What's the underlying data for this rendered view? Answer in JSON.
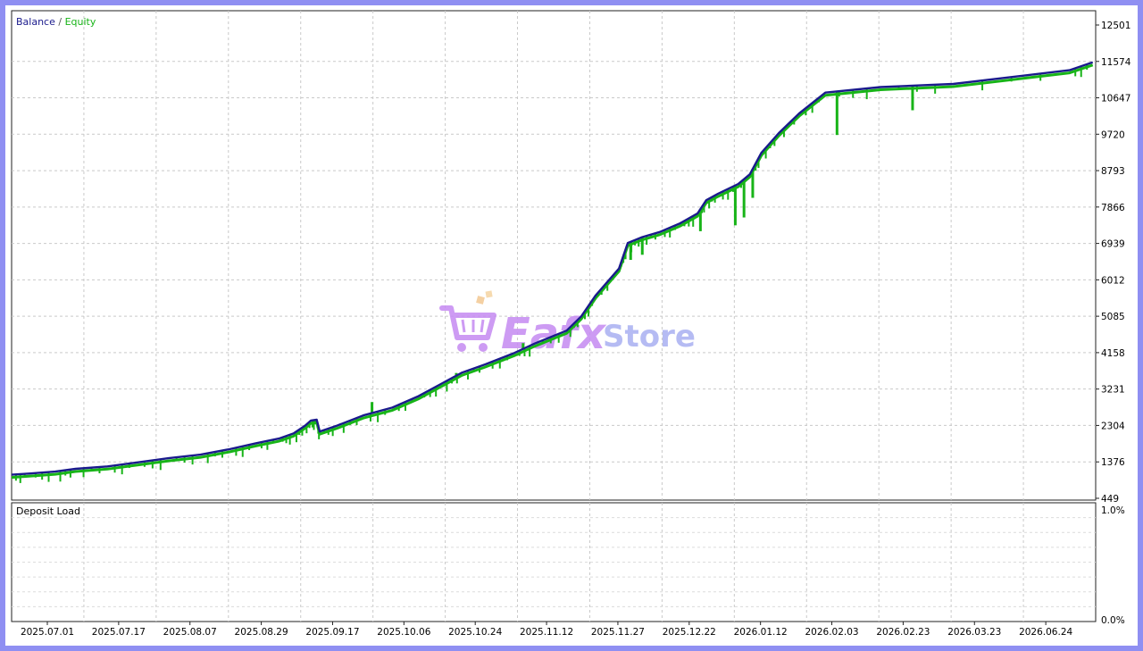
{
  "chart_data": [
    {
      "type": "line",
      "panel": "main",
      "legend": {
        "placement": "top-left",
        "entries": [
          {
            "label": "Balance",
            "color": "#1a1a8c"
          },
          {
            "label": "Equity",
            "color": "#18b418"
          }
        ],
        "separator": "/"
      },
      "ylim": [
        449,
        12501
      ],
      "yticks": [
        "12501",
        "11574",
        "10647",
        "9720",
        "8793",
        "7866",
        "6939",
        "6012",
        "5085",
        "4158",
        "3231",
        "2304",
        "1376",
        "449"
      ],
      "xlim": [
        "2025-06-25",
        "2026-07-03"
      ],
      "xticks": [
        {
          "label": "2025.07.01",
          "date": "2025-07-01"
        },
        {
          "label": "2025.07.17",
          "date": "2025-07-17"
        },
        {
          "label": "2025.08.07",
          "date": "2025-08-07"
        },
        {
          "label": "2025.08.29",
          "date": "2025-08-29"
        },
        {
          "label": "2025.09.17",
          "date": "2025-09-17"
        },
        {
          "label": "2025.10.06",
          "date": "2025-10-06"
        },
        {
          "label": "2025.10.24",
          "date": "2025-10-24"
        },
        {
          "label": "2025.11.12",
          "date": "2025-11-12"
        },
        {
          "label": "2025.11.27",
          "date": "2025-11-27"
        },
        {
          "label": "2025.12.22",
          "date": "2025-12-22"
        },
        {
          "label": "2026.01.12",
          "date": "2026-01-12"
        },
        {
          "label": "2026.02.03",
          "date": "2026-02-03"
        },
        {
          "label": "2026.02.23",
          "date": "2026-02-23"
        },
        {
          "label": "2026.03.23",
          "date": "2026-03-23"
        },
        {
          "label": "2026.06.24",
          "date": "2026-06-24"
        }
      ],
      "grid": true,
      "series": [
        {
          "name": "Balance",
          "color": "#1a1a8c",
          "points": [
            [
              "2025-06-25",
              1050
            ],
            [
              "2025-07-01",
              1080
            ],
            [
              "2025-07-10",
              1130
            ],
            [
              "2025-07-17",
              1200
            ],
            [
              "2025-07-28",
              1260
            ],
            [
              "2025-08-07",
              1360
            ],
            [
              "2025-08-18",
              1470
            ],
            [
              "2025-08-29",
              1560
            ],
            [
              "2025-09-08",
              1700
            ],
            [
              "2025-09-17",
              1850
            ],
            [
              "2025-09-25",
              1970
            ],
            [
              "2025-09-30",
              2100
            ],
            [
              "2025-10-04",
              2300
            ],
            [
              "2025-10-06",
              2430
            ],
            [
              "2025-10-08",
              2450
            ],
            [
              "2025-10-09",
              2150
            ],
            [
              "2025-10-15",
              2300
            ],
            [
              "2025-10-24",
              2560
            ],
            [
              "2025-11-03",
              2760
            ],
            [
              "2025-11-12",
              3050
            ],
            [
              "2025-11-20",
              3370
            ],
            [
              "2025-11-27",
              3650
            ],
            [
              "2025-12-05",
              3860
            ],
            [
              "2025-12-15",
              4150
            ],
            [
              "2025-12-22",
              4390
            ],
            [
              "2026-01-02",
              4720
            ],
            [
              "2026-01-07",
              5080
            ],
            [
              "2026-01-12",
              5620
            ],
            [
              "2026-01-20",
              6300
            ],
            [
              "2026-01-23",
              6950
            ],
            [
              "2026-01-28",
              7100
            ],
            [
              "2026-02-03",
              7230
            ],
            [
              "2026-02-10",
              7450
            ],
            [
              "2026-02-16",
              7700
            ],
            [
              "2026-02-19",
              8040
            ],
            [
              "2026-02-23",
              8200
            ],
            [
              "2026-03-02",
              8450
            ],
            [
              "2026-03-06",
              8700
            ],
            [
              "2026-03-10",
              9250
            ],
            [
              "2026-03-16",
              9750
            ],
            [
              "2026-03-23",
              10250
            ],
            [
              "2026-04-01",
              10780
            ],
            [
              "2026-04-20",
              10920
            ],
            [
              "2026-05-15",
              11000
            ],
            [
              "2026-06-24",
              11350
            ],
            [
              "2026-07-02",
              11550
            ]
          ]
        },
        {
          "name": "Equity",
          "color": "#18b418",
          "drawdown_spikes": [
            [
              "2026-02-17",
              7250
            ],
            [
              "2026-01-24",
              6520
            ],
            [
              "2026-01-28",
              6650
            ],
            [
              "2026-02-10",
              7430
            ],
            [
              "2026-03-01",
              7400
            ],
            [
              "2026-03-04",
              7600
            ],
            [
              "2026-03-07",
              8100
            ],
            [
              "2026-04-05",
              9700
            ],
            [
              "2026-05-01",
              10330
            ],
            [
              "2025-12-18",
              4400
            ],
            [
              "2025-11-19",
              3320
            ],
            [
              "2025-11-25",
              3640
            ],
            [
              "2025-12-29",
              4620
            ],
            [
              "2025-10-27",
              2900
            ]
          ]
        }
      ]
    },
    {
      "type": "line",
      "panel": "sub",
      "title": "Deposit Load",
      "ylim": [
        0,
        1.0
      ],
      "yticks": [
        "1.0%",
        "0.0%"
      ],
      "series": []
    }
  ],
  "watermark": {
    "text_main": "Eafx",
    "text_secondary": "Store",
    "icon": "shopping-cart-icon",
    "main_color": "#c58af2",
    "secondary_color": "#a9b0f2"
  }
}
